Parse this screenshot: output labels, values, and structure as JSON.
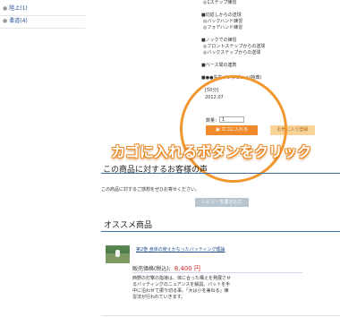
{
  "sidebar": {
    "items": [
      {
        "label": "陸上(1)"
      },
      {
        "label": "柔道(4)"
      }
    ]
  },
  "item_list": {
    "lines": [
      {
        "text": "◎1ステップ練習",
        "sub": true
      },
      {
        "text": "■切返しからの送球",
        "sub": false
      },
      {
        "text": "◎バックハンド練習",
        "sub": true
      },
      {
        "text": "◎フォアハンド練習",
        "sub": true
      },
      {
        "text": "■ノックでの練習",
        "sub": false
      },
      {
        "text": "◎フロントステップからの送球",
        "sub": true
      },
      {
        "text": "◎バックステップからの送球",
        "sub": true
      },
      {
        "text": "■ベース間の連携",
        "sub": false
      },
      {
        "text": "■●●先生インタビュー(特典)",
        "sub": false
      }
    ]
  },
  "product_info": {
    "duration": "[50分]",
    "release": "2012.07"
  },
  "cart": {
    "qty_label": "数量：",
    "qty_value": "1",
    "add_button": "カゴに入れる",
    "favorite_button": "お気に入り登録"
  },
  "caption": "カゴに入れるボタンをクリック",
  "reviews": {
    "title": "この商品に対するお客様の声",
    "empty_text": "この商品に対するご感想をぜひお寄せください。",
    "write_button": "レビューを書き込む"
  },
  "recommend": {
    "title": "オススメ商品",
    "product_title": "第2巻 身体の使えかなったバッティング理論",
    "price_label": "販売価格(税込):",
    "price": "8,400 円",
    "description": "西野の打撃の指導は、体に合った構えを発展させるバッティングのニュアンスを解説。バットを手中に沿わせて振り切る事。「大は小を兼ねる」練習法が行われていきます。"
  },
  "colors": {
    "accent": "#f08a2a",
    "link": "#1d4c8f",
    "rule": "#3d6ea8",
    "price": "#d12b2b"
  }
}
